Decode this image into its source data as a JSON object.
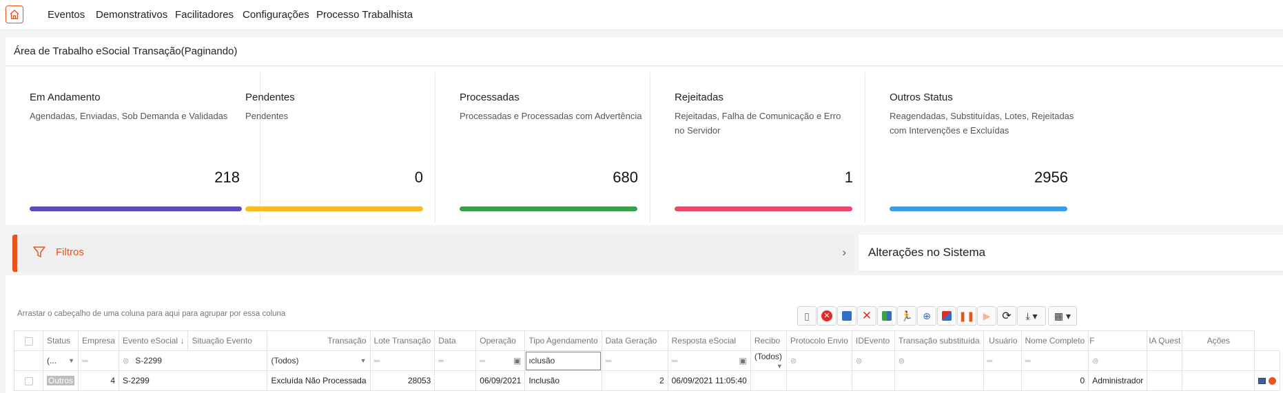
{
  "nav": {
    "items": [
      "Eventos",
      "Demonstrativos",
      "Facilitadores",
      "Configurações",
      "Processo Trabalhista"
    ]
  },
  "page": {
    "title": "Área de Trabalho eSocial Transação(Paginando)"
  },
  "cards": [
    {
      "title": "Em Andamento",
      "subtitle": "Agendadas, Enviadas, Sob Demanda e Validadas",
      "value": "218",
      "color": "#5b4bbd"
    },
    {
      "title": "Pendentes",
      "subtitle": "Pendentes",
      "value": "0",
      "color": "#f5bd1f"
    },
    {
      "title": "Processadas",
      "subtitle": "Processadas e Processadas com Advertência",
      "value": "680",
      "color": "#36a34a"
    },
    {
      "title": "Rejeitadas",
      "subtitle": "Rejeitadas, Falha de Comunicação e Erro no Servidor",
      "value": "1",
      "color": "#e84c6a"
    },
    {
      "title": "Outros Status",
      "subtitle": "Reagendadas, Substituídas, Lotes, Rejeitadas com Intervenções e Excluídas",
      "value": "2956",
      "color": "#3a9ee0"
    }
  ],
  "filters": {
    "label": "Filtros"
  },
  "changes": {
    "label": "Alterações no Sistema"
  },
  "grid": {
    "group_hint": "Arrastar o cabeçalho de uma coluna para aqui para agrupar por essa coluna",
    "columns": [
      "Status",
      "Empresa",
      "Evento eSocial",
      "Situação Evento",
      "Transação",
      "Lote Transação",
      "Data",
      "Operação",
      "Tipo Agendamento",
      "Data Geração",
      "Resposta eSocial",
      "Recibo",
      "Protocolo Envio",
      "IDEvento",
      "Transação substituída",
      "Usuário",
      "Nome Completo",
      "F",
      "IA Quest",
      "Ações"
    ],
    "sort_indicator": "↓",
    "filter_row": {
      "status": "(...",
      "evento": "S-2299",
      "situacao": "(Todos)",
      "operacao": "ıclusão",
      "resposta": "(Todos)"
    },
    "rows": [
      {
        "status": "Outros",
        "empresa": "4",
        "evento": "S-2299",
        "situacao": "Excluída Não Processada",
        "transacao": "28053",
        "lote": "",
        "data": "06/09/2021",
        "operacao": "Inclusão",
        "tipo": "2",
        "geracao": "06/09/2021 11:05:40",
        "resposta": "",
        "recibo": "",
        "protocolo": "",
        "idevento": "",
        "substituida": "",
        "usuario": "0",
        "nome": "Administrador"
      }
    ]
  }
}
